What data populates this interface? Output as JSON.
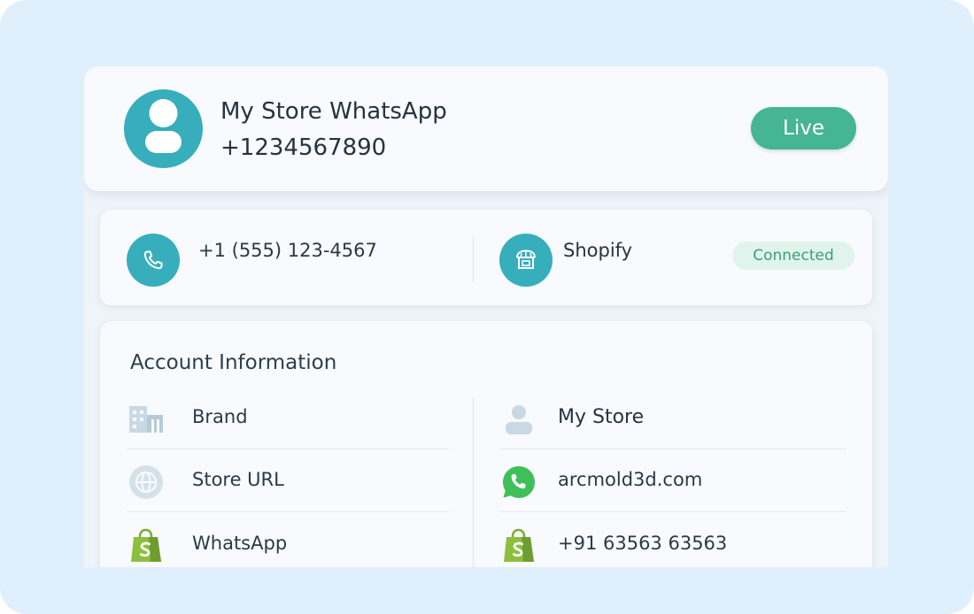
{
  "profile": {
    "name": "My Store WhatsApp",
    "phone": "+1234567890",
    "status": "Live"
  },
  "contact": {
    "phone": "+1 (555) 123-4567"
  },
  "integration": {
    "platform": "Shopify",
    "status": "Connected"
  },
  "account": {
    "title": "Account Information",
    "fields": [
      {
        "label": "Brand",
        "icon": "building-icon"
      },
      {
        "label": "Store URL",
        "icon": "globe-icon"
      },
      {
        "label": "WhatsApp",
        "icon": "shopify-bag-icon"
      }
    ],
    "values": [
      {
        "value": "My Store",
        "icon": "user-icon"
      },
      {
        "value": "arcmold3d.com",
        "icon": "whatsapp-icon"
      },
      {
        "value": "+91 63563 63563",
        "icon": "shopify-bag-icon"
      }
    ]
  },
  "colors": {
    "accent": "#36aebc",
    "live": "#45b592",
    "connected_bg": "#e0f4eb",
    "connected_text": "#3c9e77",
    "whatsapp": "#3fbf59",
    "shopify": "#8cbf3f"
  }
}
